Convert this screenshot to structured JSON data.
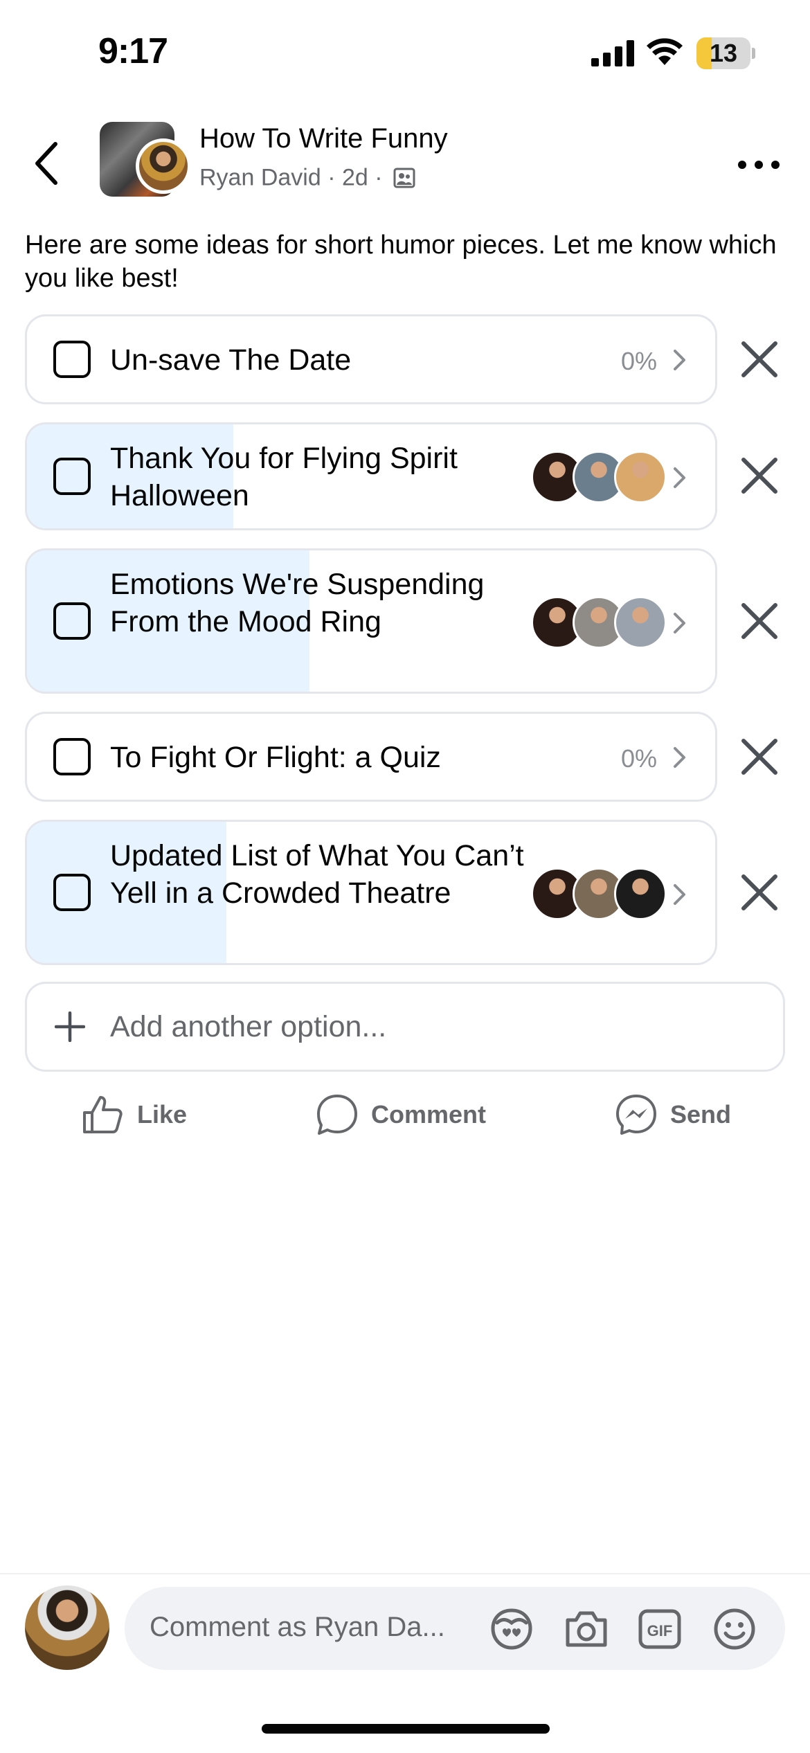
{
  "status_bar": {
    "time": "9:17",
    "battery": "13",
    "battery_level": 0.13
  },
  "post": {
    "group_title": "How To Write Funny",
    "author": "Ryan David",
    "separator": "·",
    "age": "2d",
    "text": "Here are some ideas for short humor pieces. Let me know which you like best!"
  },
  "poll": {
    "options": [
      {
        "label": "Un-save The Date",
        "percent": "0%",
        "fill": 0.0,
        "voters": []
      },
      {
        "label": "Thank You for Flying Spirit Halloween",
        "percent": "",
        "fill": 0.3,
        "voters": [
          "#2a1a16",
          "#6b7e8e",
          "#d9a86a"
        ]
      },
      {
        "label": "Emotions We're Suspending From the Mood Ring",
        "percent": "",
        "fill": 0.41,
        "voters": [
          "#2a1a16",
          "#8f8c87",
          "#9aa3ad"
        ]
      },
      {
        "label": "To Fight Or Flight: a Quiz",
        "percent": "0%",
        "fill": 0.0,
        "voters": []
      },
      {
        "label": "Updated List of What You Can’t Yell in a Crowded Theatre",
        "percent": "",
        "fill": 0.29,
        "voters": [
          "#2a1a16",
          "#7b6a55",
          "#1c1c1c"
        ]
      }
    ],
    "add_option": "Add another option..."
  },
  "actions": {
    "like": "Like",
    "comment": "Comment",
    "send": "Send"
  },
  "composer": {
    "placeholder": "Comment as Ryan Da..."
  },
  "colors": {
    "poll_fill": "#e7f3ff",
    "border": "#e4e6eb",
    "muted": "#65676b",
    "battery_accent": "#f5c83c"
  }
}
